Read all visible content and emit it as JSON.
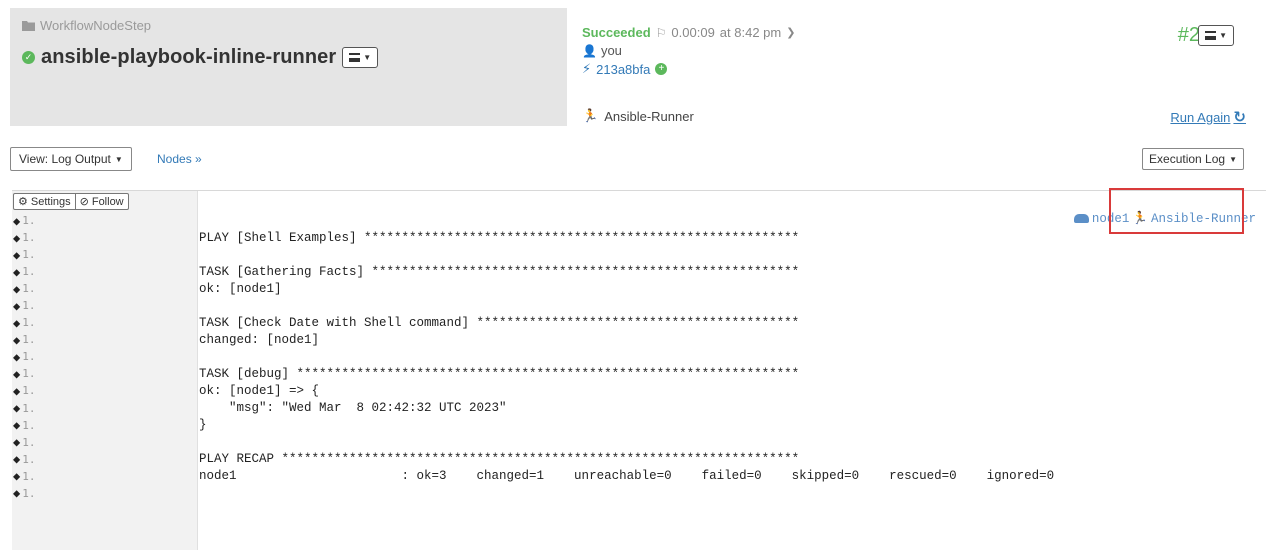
{
  "header": {
    "job_group": "WorkflowNodeStep",
    "job_title": "ansible-playbook-inline-runner",
    "status": "Succeeded",
    "duration": "0.00:09",
    "time_at": "at 8:42 pm",
    "user": "you",
    "commit": "213a8bfa",
    "runner": "Ansible-Runner",
    "exec_number": "#2",
    "run_again": "Run Again"
  },
  "toolbar": {
    "view_label": "View: Log Output",
    "nodes_link": "Nodes »",
    "exec_log_label": "Execution Log"
  },
  "log": {
    "settings_label": "Settings",
    "follow_label": "Follow",
    "node_name": "node1",
    "runner_name": "Ansible-Runner",
    "gutter_label": "1.",
    "lines": [
      "",
      "PLAY [Shell Examples] **********************************************************",
      "",
      "TASK [Gathering Facts] *********************************************************",
      "ok: [node1]",
      "",
      "TASK [Check Date with Shell command] *******************************************",
      "changed: [node1]",
      "",
      "TASK [debug] *******************************************************************",
      "ok: [node1] => {",
      "    \"msg\": \"Wed Mar  8 02:42:32 UTC 2023\"",
      "}",
      "",
      "PLAY RECAP *********************************************************************",
      "node1                      : ok=3    changed=1    unreachable=0    failed=0    skipped=0    rescued=0    ignored=0",
      ""
    ]
  },
  "colors": {
    "success": "#5cb85c",
    "link": "#337ab7",
    "highlight": "#d93a3a"
  }
}
